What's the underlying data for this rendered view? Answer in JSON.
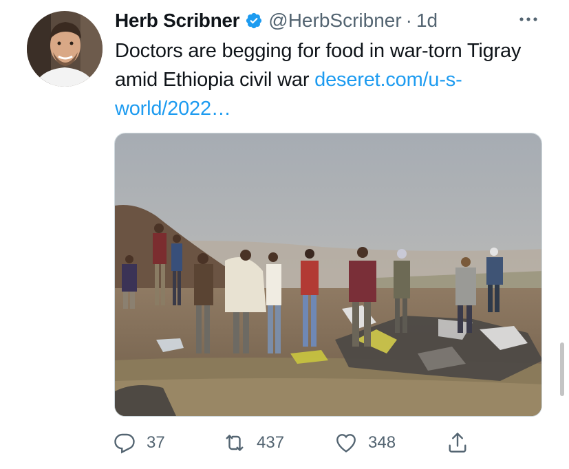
{
  "tweet": {
    "author_name": "Herb Scribner",
    "handle": "@HerbScribner",
    "separator": "·",
    "time": "1d",
    "text": "Doctors are begging for food in war-torn Tigray amid Ethiopia civil war ",
    "link_text": "deseret.com/u-s-world/2022…",
    "verified": true,
    "image_alt_subject": "people-searching-debris"
  },
  "actions": {
    "reply_count": "37",
    "retweet_count": "437",
    "like_count": "348"
  },
  "icons": {
    "verified": "verified-badge-icon",
    "more": "more-dots-icon",
    "reply": "reply-icon",
    "retweet": "retweet-icon",
    "like": "heart-icon",
    "share": "share-icon"
  },
  "colors": {
    "link": "#1d9bf0",
    "verified": "#1d9bf0",
    "muted": "#536471",
    "text": "#0f1419"
  }
}
